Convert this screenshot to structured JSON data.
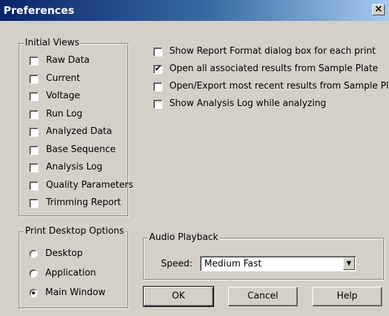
{
  "window": {
    "title": "Preferences",
    "close_icon": "close-icon"
  },
  "initial_views": {
    "label": "Initial Views",
    "items": [
      {
        "label": "Raw Data",
        "checked": false
      },
      {
        "label": "Current",
        "checked": false
      },
      {
        "label": "Voltage",
        "checked": false
      },
      {
        "label": "Run Log",
        "checked": false
      },
      {
        "label": "Analyzed Data",
        "checked": false
      },
      {
        "label": "Base Sequence",
        "checked": false
      },
      {
        "label": "Analysis Log",
        "checked": false
      },
      {
        "label": "Quality Parameters",
        "checked": false
      },
      {
        "label": "Trimming Report",
        "checked": false
      }
    ]
  },
  "options": [
    {
      "label": "Show Report Format dialog box for each print",
      "checked": false
    },
    {
      "label": "Open all associated results from Sample Plate",
      "checked": true
    },
    {
      "label": "Open/Export most recent results from Sample Plate",
      "checked": false
    },
    {
      "label": "Show Analysis Log while analyzing",
      "checked": false
    }
  ],
  "print_desktop": {
    "label": "Print Desktop Options",
    "options": [
      {
        "label": "Desktop",
        "selected": false
      },
      {
        "label": "Application",
        "selected": false
      },
      {
        "label": "Main Window",
        "selected": true
      }
    ]
  },
  "audio": {
    "label": "Audio Playback",
    "speed_label": "Speed:",
    "speed_value": "Medium Fast"
  },
  "buttons": {
    "ok": "OK",
    "cancel": "Cancel",
    "help": "Help"
  }
}
